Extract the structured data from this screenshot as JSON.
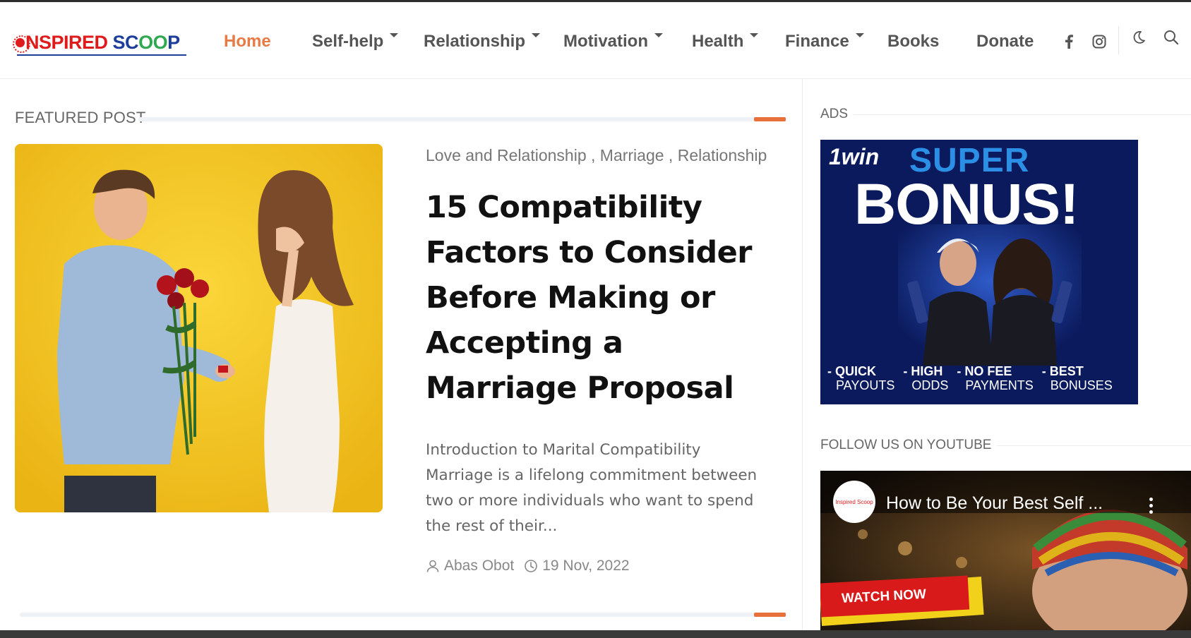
{
  "header": {
    "logo": {
      "part_red": "NSPIRED",
      "part_blue": "SC",
      "part_o": "OO",
      "part_end": "P"
    },
    "nav": [
      {
        "label": "Home",
        "active": true,
        "has_dropdown": false
      },
      {
        "label": "Self-help",
        "active": false,
        "has_dropdown": true
      },
      {
        "label": "Relationship",
        "active": false,
        "has_dropdown": true
      },
      {
        "label": "Motivation",
        "active": false,
        "has_dropdown": true
      },
      {
        "label": "Health",
        "active": false,
        "has_dropdown": true
      },
      {
        "label": "Finance",
        "active": false,
        "has_dropdown": true
      },
      {
        "label": "Books",
        "active": false,
        "has_dropdown": false
      },
      {
        "label": "Donate",
        "active": false,
        "has_dropdown": false
      }
    ],
    "icons": [
      "facebook-icon",
      "instagram-icon",
      "moon-icon",
      "search-icon"
    ]
  },
  "featured": {
    "section_title": "FEATURED POST",
    "categories": [
      "Love and Relationship",
      "Marriage",
      "Relationship"
    ],
    "title": "15 Compatibility Factors to Consider Before Making or Accepting a Marriage Proposal",
    "excerpt": "Introduction to Marital Compatibility Marriage is a lifelong commitment between two or more individuals who want to spend the rest of their...",
    "author": "Abas Obot",
    "date": "19 Nov, 2022"
  },
  "sidebar": {
    "ads_title": "ADS",
    "ad": {
      "brand": "1win",
      "headline1": "SUPER",
      "headline2": "BONUS!",
      "features": [
        {
          "line1": "- QUICK",
          "line2": "PAYOUTS"
        },
        {
          "line1": "- HIGH",
          "line2": "ODDS"
        },
        {
          "line1": "- NO FEE",
          "line2": "PAYMENTS"
        },
        {
          "line1": "- BEST",
          "line2": "BONUSES"
        }
      ]
    },
    "youtube_title": "FOLLOW US ON YOUTUBE",
    "video": {
      "title": "How to Be Your Best Self ...",
      "channel_badge": "Inspired Scoop",
      "cta": "WATCH NOW"
    }
  },
  "colors": {
    "accent": "#e8703a",
    "nav_active": "#e87a45",
    "logo_red": "#e01b1b",
    "logo_blue": "#1d3f9a"
  }
}
